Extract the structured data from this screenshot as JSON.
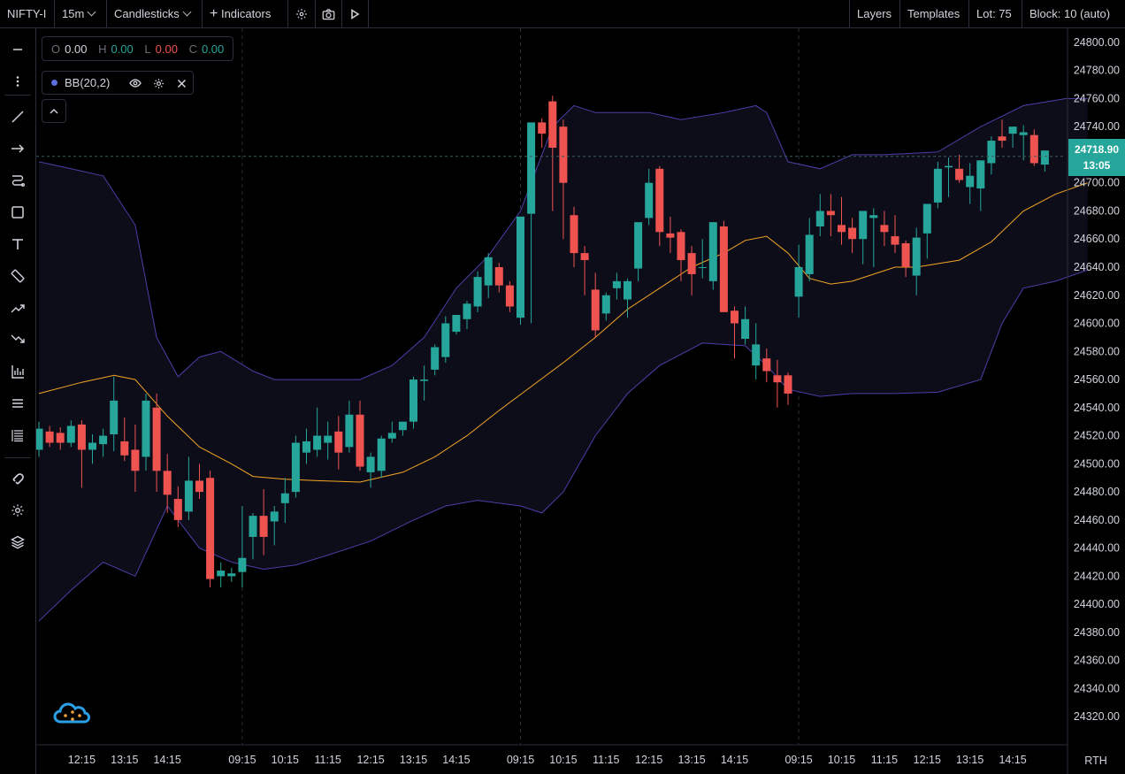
{
  "topbar": {
    "symbol": "NIFTY-I",
    "interval": "15m",
    "chart_style": "Candlesticks",
    "indicators_label": "Indicators",
    "layers_label": "Layers",
    "templates_label": "Templates",
    "lot_label": "Lot: 75",
    "block_label": "Block: 10 (auto)"
  },
  "legend": {
    "open_key": "O",
    "open_value": "0.00",
    "high_key": "H",
    "high_value": "0.00",
    "low_key": "L",
    "low_value": "0.00",
    "close_key": "C",
    "close_value": "0.00",
    "indicator_label": "BB(20,2)"
  },
  "last_price": {
    "value": "24718.90",
    "countdown": "13:05"
  },
  "axis_footer": "RTH",
  "colors": {
    "up": "#26a69a",
    "down": "#ef5350",
    "band": "#4b3fa8",
    "basis": "#f5a623",
    "band_fill": "#0d0d1a",
    "grid": "#2a2e39",
    "axis_text": "#d1d4dc"
  },
  "chart_data": {
    "type": "candlestick",
    "indicator": "Bollinger Bands (20,2)",
    "ylim": [
      24300,
      24810
    ],
    "y_ticks": [
      24320,
      24340,
      24360,
      24380,
      24400,
      24420,
      24440,
      24460,
      24480,
      24500,
      24520,
      24540,
      24560,
      24580,
      24600,
      24620,
      24640,
      24660,
      24680,
      24700,
      24720,
      24740,
      24760,
      24780,
      24800
    ],
    "x_tick_labels": [
      {
        "i": 4,
        "label": "12:15"
      },
      {
        "i": 8,
        "label": "13:15"
      },
      {
        "i": 12,
        "label": "14:15"
      },
      {
        "i": 19,
        "label": "09:15"
      },
      {
        "i": 23,
        "label": "10:15"
      },
      {
        "i": 27,
        "label": "11:15"
      },
      {
        "i": 31,
        "label": "12:15"
      },
      {
        "i": 35,
        "label": "13:15"
      },
      {
        "i": 39,
        "label": "14:15"
      },
      {
        "i": 45,
        "label": "09:15"
      },
      {
        "i": 49,
        "label": "10:15"
      },
      {
        "i": 53,
        "label": "11:15"
      },
      {
        "i": 57,
        "label": "12:15"
      },
      {
        "i": 61,
        "label": "13:15"
      },
      {
        "i": 65,
        "label": "14:15"
      },
      {
        "i": 71,
        "label": "09:15"
      },
      {
        "i": 75,
        "label": "10:15"
      },
      {
        "i": 79,
        "label": "11:15"
      },
      {
        "i": 83,
        "label": "12:15"
      },
      {
        "i": 87,
        "label": "13:15"
      },
      {
        "i": 91,
        "label": "14:15"
      }
    ],
    "session_breaks": [
      19,
      45,
      71
    ],
    "candles": [
      [
        24510,
        24530,
        24505,
        24525
      ],
      [
        24523,
        24527,
        24512,
        24515
      ],
      [
        24522,
        24526,
        24510,
        24515
      ],
      [
        24515,
        24531,
        24512,
        24527
      ],
      [
        24528,
        24531,
        24483,
        24510
      ],
      [
        24510,
        24521,
        24500,
        24515
      ],
      [
        24514,
        24525,
        24505,
        24520
      ],
      [
        24521,
        24562,
        24509,
        24545
      ],
      [
        24516,
        24533,
        24502,
        24506
      ],
      [
        24510,
        24528,
        24480,
        24495
      ],
      [
        24505,
        24550,
        24495,
        24545
      ],
      [
        24540,
        24550,
        24480,
        24495
      ],
      [
        24495,
        24507,
        24465,
        24478
      ],
      [
        24475,
        24484,
        24455,
        24460
      ],
      [
        24466,
        24505,
        24460,
        24488
      ],
      [
        24488,
        24500,
        24475,
        24480
      ],
      [
        24490,
        24495,
        24412,
        24418
      ],
      [
        24420,
        24430,
        24412,
        24424
      ],
      [
        24420,
        24426,
        24416,
        24422
      ],
      [
        24423,
        24470,
        24412,
        24433
      ],
      [
        24448,
        24465,
        24432,
        24463
      ],
      [
        24463,
        24482,
        24435,
        24448
      ],
      [
        24459,
        24470,
        24442,
        24466
      ],
      [
        24472,
        24490,
        24458,
        24479
      ],
      [
        24480,
        24520,
        24476,
        24515
      ],
      [
        24508,
        24525,
        24500,
        24516
      ],
      [
        24510,
        24540,
        24505,
        24520
      ],
      [
        24515,
        24530,
        24503,
        24520
      ],
      [
        24523,
        24534,
        24496,
        24508
      ],
      [
        24512,
        24545,
        24508,
        24535
      ],
      [
        24535,
        24545,
        24495,
        24498
      ],
      [
        24494,
        24508,
        24483,
        24505
      ],
      [
        24495,
        24520,
        24490,
        24518
      ],
      [
        24518,
        24530,
        24515,
        24522
      ],
      [
        24524,
        24530,
        24520,
        24530
      ],
      [
        24530,
        24562,
        24525,
        24560
      ],
      [
        24559,
        24570,
        24545,
        24560
      ],
      [
        24567,
        24585,
        24563,
        24583
      ],
      [
        24576,
        24605,
        24572,
        24600
      ],
      [
        24594,
        24606,
        24592,
        24606
      ],
      [
        24603,
        24616,
        24596,
        24614
      ],
      [
        24612,
        24637,
        24608,
        24633
      ],
      [
        24627,
        24650,
        24618,
        24647
      ],
      [
        24640,
        24643,
        24622,
        24627
      ],
      [
        24627,
        24630,
        24608,
        24612
      ],
      [
        24604,
        24667,
        24599,
        24676
      ],
      [
        24678,
        24697,
        24600,
        24743
      ],
      [
        24743,
        24746,
        24725,
        24735
      ],
      [
        24758,
        24762,
        24680,
        24725
      ],
      [
        24740,
        24745,
        24660,
        24700
      ],
      [
        24677,
        24683,
        24640,
        24650
      ],
      [
        24650,
        24655,
        24620,
        24645
      ],
      [
        24624,
        24636,
        24590,
        24595
      ],
      [
        24607,
        24622,
        24602,
        24620
      ],
      [
        24625,
        24636,
        24617,
        24630
      ],
      [
        24617,
        24632,
        24604,
        24630
      ],
      [
        24639,
        24670,
        24630,
        24672
      ],
      [
        24675,
        24710,
        24670,
        24700
      ],
      [
        24710,
        24712,
        24655,
        24665
      ],
      [
        24664,
        24676,
        24650,
        24661
      ],
      [
        24665,
        24667,
        24630,
        24645
      ],
      [
        24650,
        24655,
        24620,
        24635
      ],
      [
        24640,
        24660,
        24632,
        24640
      ],
      [
        24630,
        24672,
        24624,
        24672
      ],
      [
        24669,
        24673,
        24626,
        24608
      ],
      [
        24609,
        24612,
        24575,
        24600
      ],
      [
        24589,
        24612,
        24585,
        24603
      ],
      [
        24570,
        24600,
        24560,
        24585
      ],
      [
        24575,
        24582,
        24558,
        24566
      ],
      [
        24563,
        24574,
        24540,
        24558
      ],
      [
        24563,
        24565,
        24542,
        24550
      ],
      [
        24619,
        24656,
        24604,
        24640
      ],
      [
        24635,
        24675,
        24630,
        24663
      ],
      [
        24669,
        24692,
        24662,
        24680
      ],
      [
        24680,
        24692,
        24662,
        24677
      ],
      [
        24670,
        24690,
        24656,
        24665
      ],
      [
        24668,
        24675,
        24650,
        24660
      ],
      [
        24660,
        24672,
        24642,
        24680
      ],
      [
        24675,
        24682,
        24640,
        24677
      ],
      [
        24670,
        24680,
        24655,
        24665
      ],
      [
        24662,
        24677,
        24650,
        24656
      ],
      [
        24657,
        24659,
        24633,
        24640
      ],
      [
        24634,
        24668,
        24620,
        24661
      ],
      [
        24664,
        24680,
        24646,
        24685
      ],
      [
        24686,
        24715,
        24682,
        24710
      ],
      [
        24711,
        24718,
        24690,
        24712
      ],
      [
        24710,
        24720,
        24700,
        24702
      ],
      [
        24697,
        24714,
        24685,
        24705
      ],
      [
        24696,
        24712,
        24680,
        24716
      ],
      [
        24714,
        24733,
        24706,
        24730
      ],
      [
        24733,
        24745,
        24725,
        24730
      ],
      [
        24735,
        24740,
        24725,
        24740
      ],
      [
        24734,
        24741,
        24716,
        24736
      ],
      [
        24734,
        24738,
        24712,
        24714
      ],
      [
        24713,
        24722,
        24708,
        24723
      ]
    ],
    "basis": [
      [
        0,
        24550
      ],
      [
        4,
        24558
      ],
      [
        7,
        24563
      ],
      [
        9,
        24560
      ],
      [
        12,
        24534
      ],
      [
        15,
        24512
      ],
      [
        18,
        24500
      ],
      [
        20,
        24491
      ],
      [
        23,
        24489
      ],
      [
        26,
        24488
      ],
      [
        30,
        24487
      ],
      [
        34,
        24494
      ],
      [
        37,
        24505
      ],
      [
        40,
        24520
      ],
      [
        43,
        24538
      ],
      [
        46,
        24555
      ],
      [
        49,
        24572
      ],
      [
        52,
        24590
      ],
      [
        55,
        24610
      ],
      [
        58,
        24625
      ],
      [
        61,
        24640
      ],
      [
        64,
        24650
      ],
      [
        66,
        24659
      ],
      [
        68,
        24662
      ],
      [
        70,
        24650
      ],
      [
        72,
        24632
      ],
      [
        74,
        24628
      ],
      [
        76,
        24630
      ],
      [
        80,
        24640
      ],
      [
        82,
        24640
      ],
      [
        86,
        24645
      ],
      [
        89,
        24658
      ],
      [
        92,
        24680
      ],
      [
        95,
        24692
      ],
      [
        98,
        24700
      ]
    ],
    "upper": [
      [
        0,
        24715
      ],
      [
        3,
        24710
      ],
      [
        6,
        24705
      ],
      [
        9,
        24670
      ],
      [
        11,
        24590
      ],
      [
        13,
        24562
      ],
      [
        15,
        24576
      ],
      [
        17,
        24580
      ],
      [
        20,
        24566
      ],
      [
        22,
        24560
      ],
      [
        24,
        24560
      ],
      [
        27,
        24560
      ],
      [
        30,
        24560
      ],
      [
        33,
        24570
      ],
      [
        36,
        24590
      ],
      [
        39,
        24625
      ],
      [
        42,
        24648
      ],
      [
        45,
        24680
      ],
      [
        48,
        24740
      ],
      [
        50,
        24755
      ],
      [
        52,
        24750
      ],
      [
        57,
        24750
      ],
      [
        60,
        24745
      ],
      [
        64,
        24750
      ],
      [
        67,
        24755
      ],
      [
        68,
        24750
      ],
      [
        70,
        24715
      ],
      [
        73,
        24710
      ],
      [
        76,
        24720
      ],
      [
        79,
        24720
      ],
      [
        84,
        24722
      ],
      [
        88,
        24740
      ],
      [
        92,
        24755
      ],
      [
        96,
        24760
      ],
      [
        98,
        24760
      ]
    ],
    "lower": [
      [
        0,
        24388
      ],
      [
        3,
        24410
      ],
      [
        6,
        24430
      ],
      [
        9,
        24420
      ],
      [
        12,
        24470
      ],
      [
        15,
        24440
      ],
      [
        18,
        24430
      ],
      [
        21,
        24425
      ],
      [
        24,
        24428
      ],
      [
        27,
        24435
      ],
      [
        31,
        24445
      ],
      [
        35,
        24460
      ],
      [
        38,
        24470
      ],
      [
        41,
        24474
      ],
      [
        45,
        24470
      ],
      [
        47,
        24465
      ],
      [
        49,
        24480
      ],
      [
        52,
        24520
      ],
      [
        55,
        24550
      ],
      [
        58,
        24570
      ],
      [
        62,
        24586
      ],
      [
        64,
        24585
      ],
      [
        66,
        24584
      ],
      [
        68,
        24570
      ],
      [
        70,
        24553
      ],
      [
        73,
        24548
      ],
      [
        76,
        24550
      ],
      [
        80,
        24550
      ],
      [
        84,
        24551
      ],
      [
        88,
        24560
      ],
      [
        90,
        24600
      ],
      [
        92,
        24625
      ],
      [
        95,
        24630
      ],
      [
        98,
        24638
      ]
    ]
  }
}
